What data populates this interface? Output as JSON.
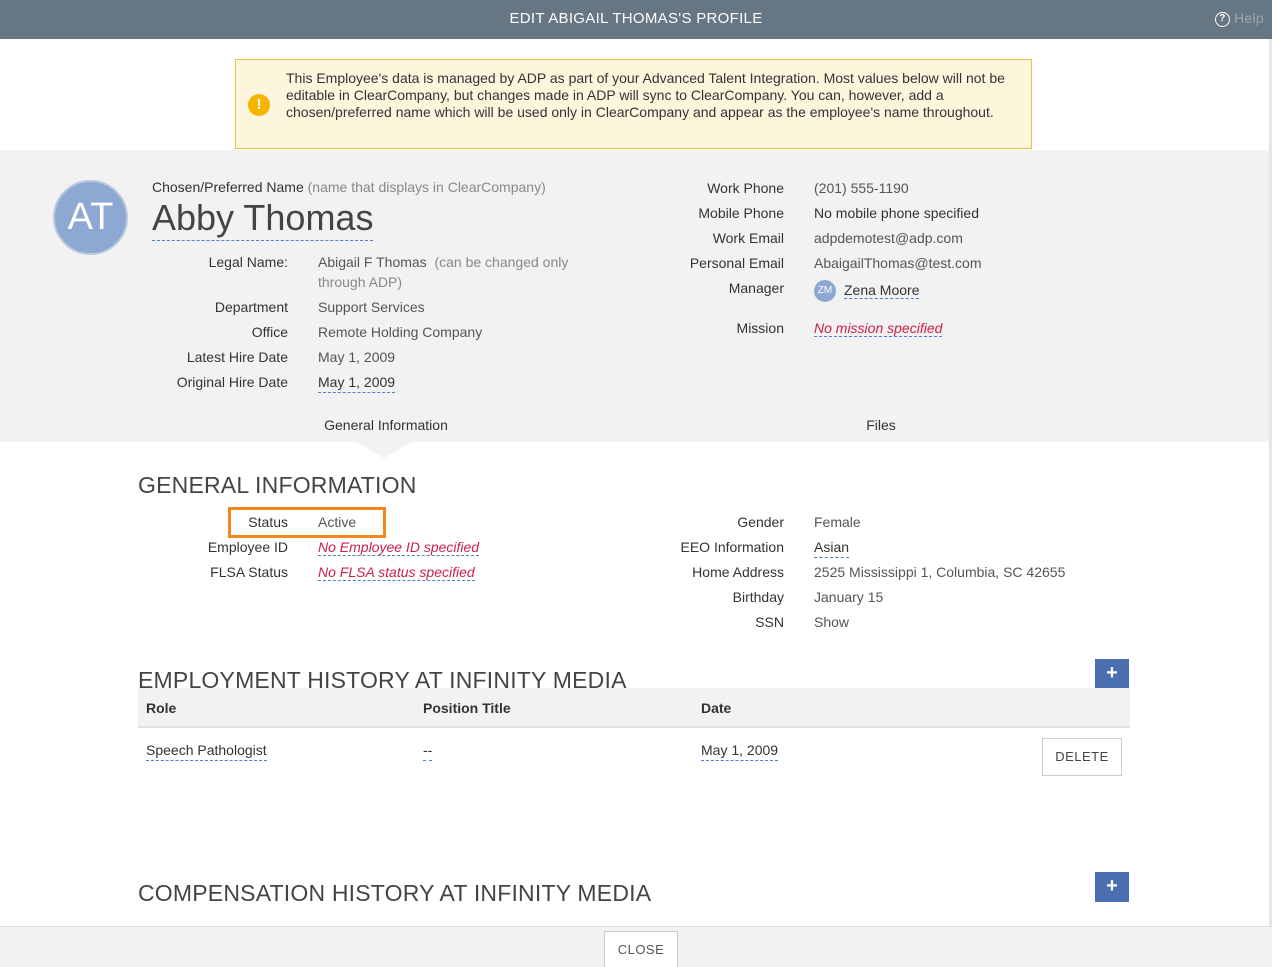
{
  "window": {
    "title": "EDIT ABIGAIL THOMAS'S PROFILE",
    "help_label": "Help",
    "help_icon": "question-circle-icon"
  },
  "notice": {
    "icon": "warning-icon",
    "text": "This Employee's data is managed by ADP as part of your Advanced Talent Integration. Most values below will not be editable in ClearCompany, but changes made in ADP will sync to ClearCompany. You can, however, add a chosen/preferred name which will be used only in ClearCompany and appear as the employee's name throughout."
  },
  "profile": {
    "avatar_initials": "AT",
    "preferred_label": "Chosen/Preferred Name",
    "preferred_hint": "(name that displays in ClearCompany)",
    "preferred_name": "Abby Thomas",
    "left_fields": {
      "legal_name": {
        "label": "Legal Name:",
        "value": "Abigail F Thomas",
        "hint": "(can be changed only through ADP)"
      },
      "department": {
        "label": "Department",
        "value": "Support Services"
      },
      "office": {
        "label": "Office",
        "value": "Remote Holding Company"
      },
      "latest_hire": {
        "label": "Latest Hire Date",
        "value": "May 1, 2009"
      },
      "original_hire": {
        "label": "Original Hire Date",
        "value": "May 1, 2009"
      }
    },
    "right_fields": {
      "work_phone": {
        "label": "Work Phone",
        "value": "(201) 555-1190"
      },
      "mobile_phone": {
        "label": "Mobile Phone",
        "value": "No mobile phone specified"
      },
      "work_email": {
        "label": "Work Email",
        "value": "adpdemotest@adp.com"
      },
      "personal_email": {
        "label": "Personal Email",
        "value": "AbaigailThomas@test.com"
      },
      "manager": {
        "label": "Manager",
        "initials": "ZM",
        "value": "Zena Moore"
      },
      "mission": {
        "label": "Mission",
        "value": "No mission specified"
      }
    }
  },
  "tabs": [
    {
      "label": "General Information"
    },
    {
      "label": "Files"
    }
  ],
  "general": {
    "title": "GENERAL INFORMATION",
    "status": {
      "label": "Status",
      "value": "Active"
    },
    "employee_id": {
      "label": "Employee ID",
      "value": "No Employee ID specified"
    },
    "flsa": {
      "label": "FLSA Status",
      "value": "No FLSA status specified"
    },
    "gender": {
      "label": "Gender",
      "value": "Female"
    },
    "eeo": {
      "label": "EEO Information",
      "value": "Asian"
    },
    "address": {
      "label": "Home Address",
      "value": "2525 Mississippi 1, Columbia, SC 42655"
    },
    "birthday": {
      "label": "Birthday",
      "value": "January 15"
    },
    "ssn": {
      "label": "SSN",
      "value": "Show"
    }
  },
  "employment": {
    "title": "EMPLOYMENT HISTORY AT INFINITY MEDIA",
    "add_label": "+",
    "columns": [
      "Role",
      "Position Title",
      "Date"
    ],
    "rows": [
      {
        "role": "Speech Pathologist",
        "position": "--",
        "date": "May 1, 2009",
        "delete_label": "DELETE"
      }
    ]
  },
  "compensation": {
    "title": "COMPENSATION HISTORY AT INFINITY MEDIA",
    "add_label": "+"
  },
  "footer": {
    "close_label": "CLOSE"
  },
  "colors": {
    "titlebar": "#667683",
    "accent": "#4a6fb0",
    "highlight": "#f5871f",
    "error": "#cc1f48"
  }
}
